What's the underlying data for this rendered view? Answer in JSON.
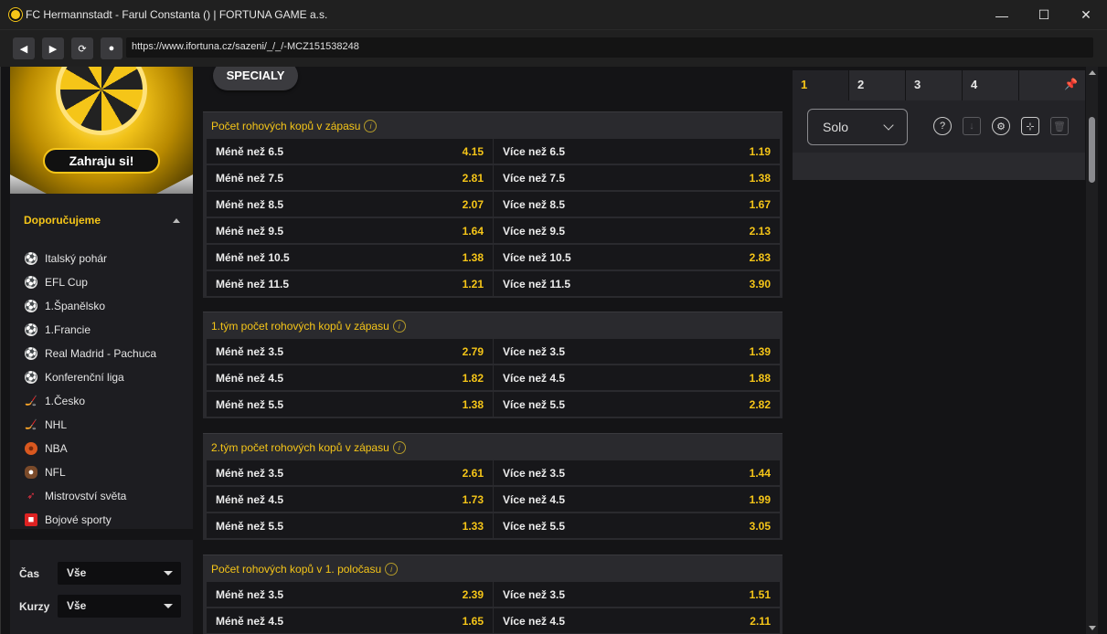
{
  "window": {
    "title": "FC Hermannstadt - Farul Constanta () | FORTUNA GAME a.s.",
    "minimize": "—",
    "maximize": "☐",
    "close": "✕"
  },
  "nav": {
    "back": "◀",
    "forward": "▶",
    "reload": "⟳",
    "stop": "●",
    "url": "https://www.ifortuna.cz/sazeni/_/_/-MCZ151538248"
  },
  "sidebar": {
    "banner_button": "Zahraju si!",
    "section_title": "Doporučujeme",
    "items": [
      {
        "label": "Italský pohár",
        "icon": "soccer-ball-icon",
        "glyph": "⚽"
      },
      {
        "label": "EFL Cup",
        "icon": "soccer-ball-icon",
        "glyph": "⚽"
      },
      {
        "label": "1.Španělsko",
        "icon": "soccer-ball-icon",
        "glyph": "⚽"
      },
      {
        "label": "1.Francie",
        "icon": "soccer-ball-icon",
        "glyph": "⚽"
      },
      {
        "label": "Real Madrid - Pachuca",
        "icon": "soccer-ball-icon",
        "glyph": "⚽"
      },
      {
        "label": "Konferenční liga",
        "icon": "soccer-ball-icon",
        "glyph": "⚽"
      },
      {
        "label": "1.Česko",
        "icon": "hockey-icon",
        "glyph": "🏒"
      },
      {
        "label": "NHL",
        "icon": "hockey-icon",
        "glyph": "🏒"
      },
      {
        "label": "NBA",
        "icon": "basketball-icon",
        "glyph": "●"
      },
      {
        "label": "NFL",
        "icon": "american-football-icon",
        "glyph": "●"
      },
      {
        "label": "Mistrovství světa",
        "icon": "darts-icon",
        "glyph": "➶"
      },
      {
        "label": "Bojové sporty",
        "icon": "boxing-icon",
        "glyph": "■"
      }
    ],
    "filters": {
      "time_label": "Čas",
      "time_value": "Vše",
      "odds_label": "Kurzy",
      "odds_value": "Vše"
    }
  },
  "content": {
    "tab_label": "SPECIALY",
    "markets": [
      {
        "title": "Počet rohových kopů v zápasu",
        "rows": [
          [
            {
              "label": "Méně než 6.5",
              "odd": "4.15"
            },
            {
              "label": "Více než 6.5",
              "odd": "1.19"
            }
          ],
          [
            {
              "label": "Méně než 7.5",
              "odd": "2.81"
            },
            {
              "label": "Více než 7.5",
              "odd": "1.38"
            }
          ],
          [
            {
              "label": "Méně než 8.5",
              "odd": "2.07"
            },
            {
              "label": "Více než 8.5",
              "odd": "1.67"
            }
          ],
          [
            {
              "label": "Méně než 9.5",
              "odd": "1.64"
            },
            {
              "label": "Více než 9.5",
              "odd": "2.13"
            }
          ],
          [
            {
              "label": "Méně než 10.5",
              "odd": "1.38"
            },
            {
              "label": "Více než 10.5",
              "odd": "2.83"
            }
          ],
          [
            {
              "label": "Méně než 11.5",
              "odd": "1.21"
            },
            {
              "label": "Více než 11.5",
              "odd": "3.90"
            }
          ]
        ]
      },
      {
        "title": "1.tým počet rohových kopů v zápasu",
        "rows": [
          [
            {
              "label": "Méně než 3.5",
              "odd": "2.79"
            },
            {
              "label": "Více než 3.5",
              "odd": "1.39"
            }
          ],
          [
            {
              "label": "Méně než 4.5",
              "odd": "1.82"
            },
            {
              "label": "Více než 4.5",
              "odd": "1.88"
            }
          ],
          [
            {
              "label": "Méně než 5.5",
              "odd": "1.38"
            },
            {
              "label": "Více než 5.5",
              "odd": "2.82"
            }
          ]
        ]
      },
      {
        "title": "2.tým počet rohových kopů v zápasu",
        "rows": [
          [
            {
              "label": "Méně než 3.5",
              "odd": "2.61"
            },
            {
              "label": "Více než 3.5",
              "odd": "1.44"
            }
          ],
          [
            {
              "label": "Méně než 4.5",
              "odd": "1.73"
            },
            {
              "label": "Více než 4.5",
              "odd": "1.99"
            }
          ],
          [
            {
              "label": "Méně než 5.5",
              "odd": "1.33"
            },
            {
              "label": "Více než 5.5",
              "odd": "3.05"
            }
          ]
        ]
      },
      {
        "title": "Počet rohových kopů v 1. poločasu",
        "rows": [
          [
            {
              "label": "Méně než 3.5",
              "odd": "2.39"
            },
            {
              "label": "Více než 3.5",
              "odd": "1.51"
            }
          ],
          [
            {
              "label": "Méně než 4.5",
              "odd": "1.65"
            },
            {
              "label": "Více než 4.5",
              "odd": "2.11"
            }
          ]
        ]
      }
    ]
  },
  "slip": {
    "tabs": [
      "1",
      "2",
      "3",
      "4"
    ],
    "active_tab": "1",
    "pin_icon": "📌",
    "mode": "Solo",
    "icons": [
      {
        "name": "help-icon",
        "glyph": "?"
      },
      {
        "name": "sort-icon",
        "glyph": "↓"
      },
      {
        "name": "settings-icon",
        "glyph": "⚙"
      },
      {
        "name": "collapse-icon",
        "glyph": "⊹"
      },
      {
        "name": "trash-icon",
        "glyph": "🗑"
      }
    ]
  },
  "colors": {
    "accent": "#f5c518",
    "background": "#141416",
    "panel": "#2a2a2e",
    "odd_cell": "#17171a"
  }
}
